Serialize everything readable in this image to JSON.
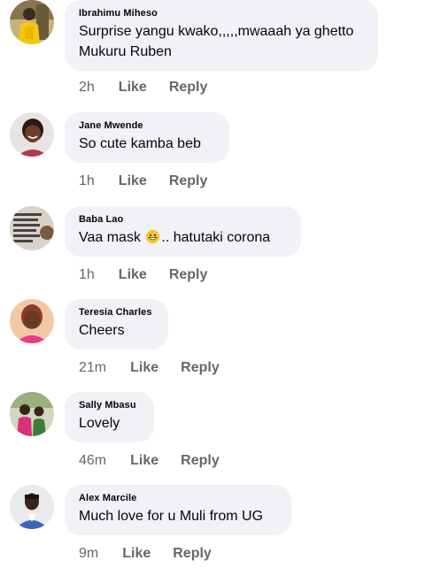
{
  "comments": [
    {
      "author": "Ibrahimu Miheso",
      "text": "Surprise yangu kwako,,,,,mwaaah ya ghetto Mukuru Ruben",
      "time": "2h",
      "like_label": "Like",
      "reply_label": "Reply",
      "avatar": "photo-man-yellow"
    },
    {
      "author": "Jane Mwende",
      "text": "So cute  kamba beb",
      "time": "1h",
      "like_label": "Like",
      "reply_label": "Reply",
      "avatar": "photo-woman-smiling"
    },
    {
      "author": "Baba Lao",
      "text_before": "Vaa mask ",
      "emoji": "grinning-face-emoji",
      "text_after": ".. hatutaki corona",
      "time": "1h",
      "like_label": "Like",
      "reply_label": "Reply",
      "avatar": "text-image-quote"
    },
    {
      "author": "Teresia Charles",
      "text": "Cheers",
      "time": "21m",
      "like_label": "Like",
      "reply_label": "Reply",
      "avatar": "photo-woman-pink"
    },
    {
      "author": "Sally Mbasu",
      "text": "Lovely",
      "time": "46m",
      "like_label": "Like",
      "reply_label": "Reply",
      "avatar": "photo-two-people"
    },
    {
      "author": "Alex Marcile",
      "text": "Much love for u Muli from UG",
      "time": "9m",
      "like_label": "Like",
      "reply_label": "Reply",
      "avatar": "photo-man-blue-shirt"
    }
  ],
  "colors": {
    "bubble": "#f0f2f5",
    "text": "#050505",
    "meta": "#65676b"
  }
}
